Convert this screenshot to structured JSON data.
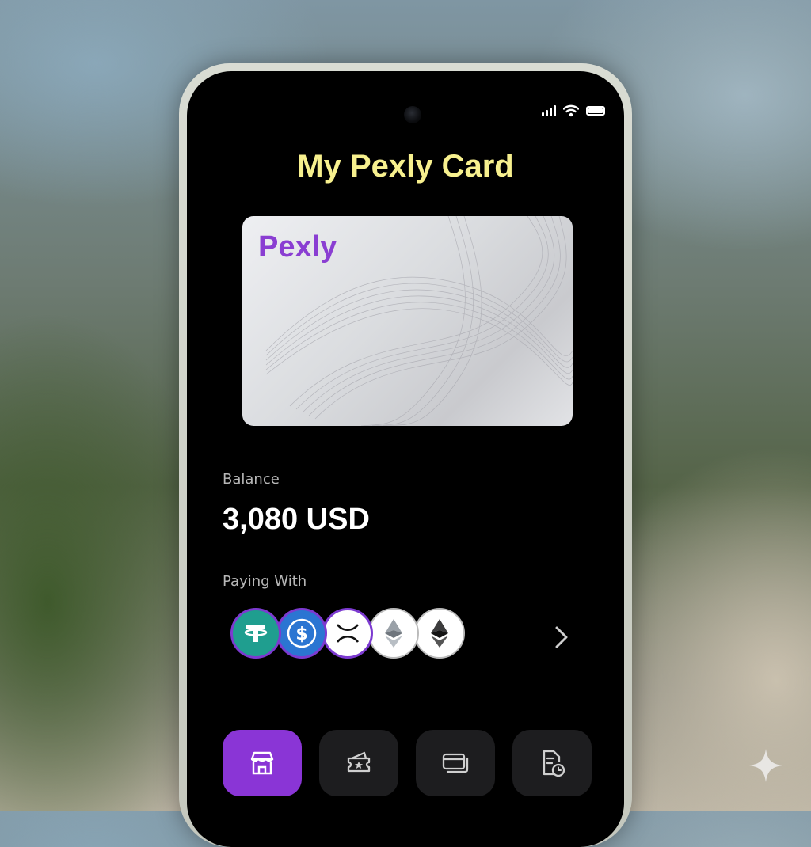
{
  "status_bar": {
    "icons": [
      "signal-icon",
      "wifi-icon",
      "battery-icon"
    ]
  },
  "header": {
    "title": "My Pexly Card"
  },
  "card": {
    "brand": "Pexly",
    "brand_color": "#8a3ed2"
  },
  "balance": {
    "label": "Balance",
    "value": "3,080 USD"
  },
  "paying_with": {
    "label": "Paying With",
    "coins": [
      "tether-icon",
      "usd-coin-icon",
      "xrp-icon",
      "ethereum-classic-icon",
      "ethereum-icon"
    ],
    "more_icon": "chevron-right-icon"
  },
  "tab_bar": {
    "tabs": [
      {
        "icon": "store-icon",
        "active": true
      },
      {
        "icon": "ticket-star-icon",
        "active": false
      },
      {
        "icon": "card-icon",
        "active": false
      },
      {
        "icon": "history-document-icon",
        "active": false
      }
    ]
  },
  "colors": {
    "title": "#f7f08e",
    "accent": "#8a35d6",
    "screen_bg": "#000000"
  }
}
